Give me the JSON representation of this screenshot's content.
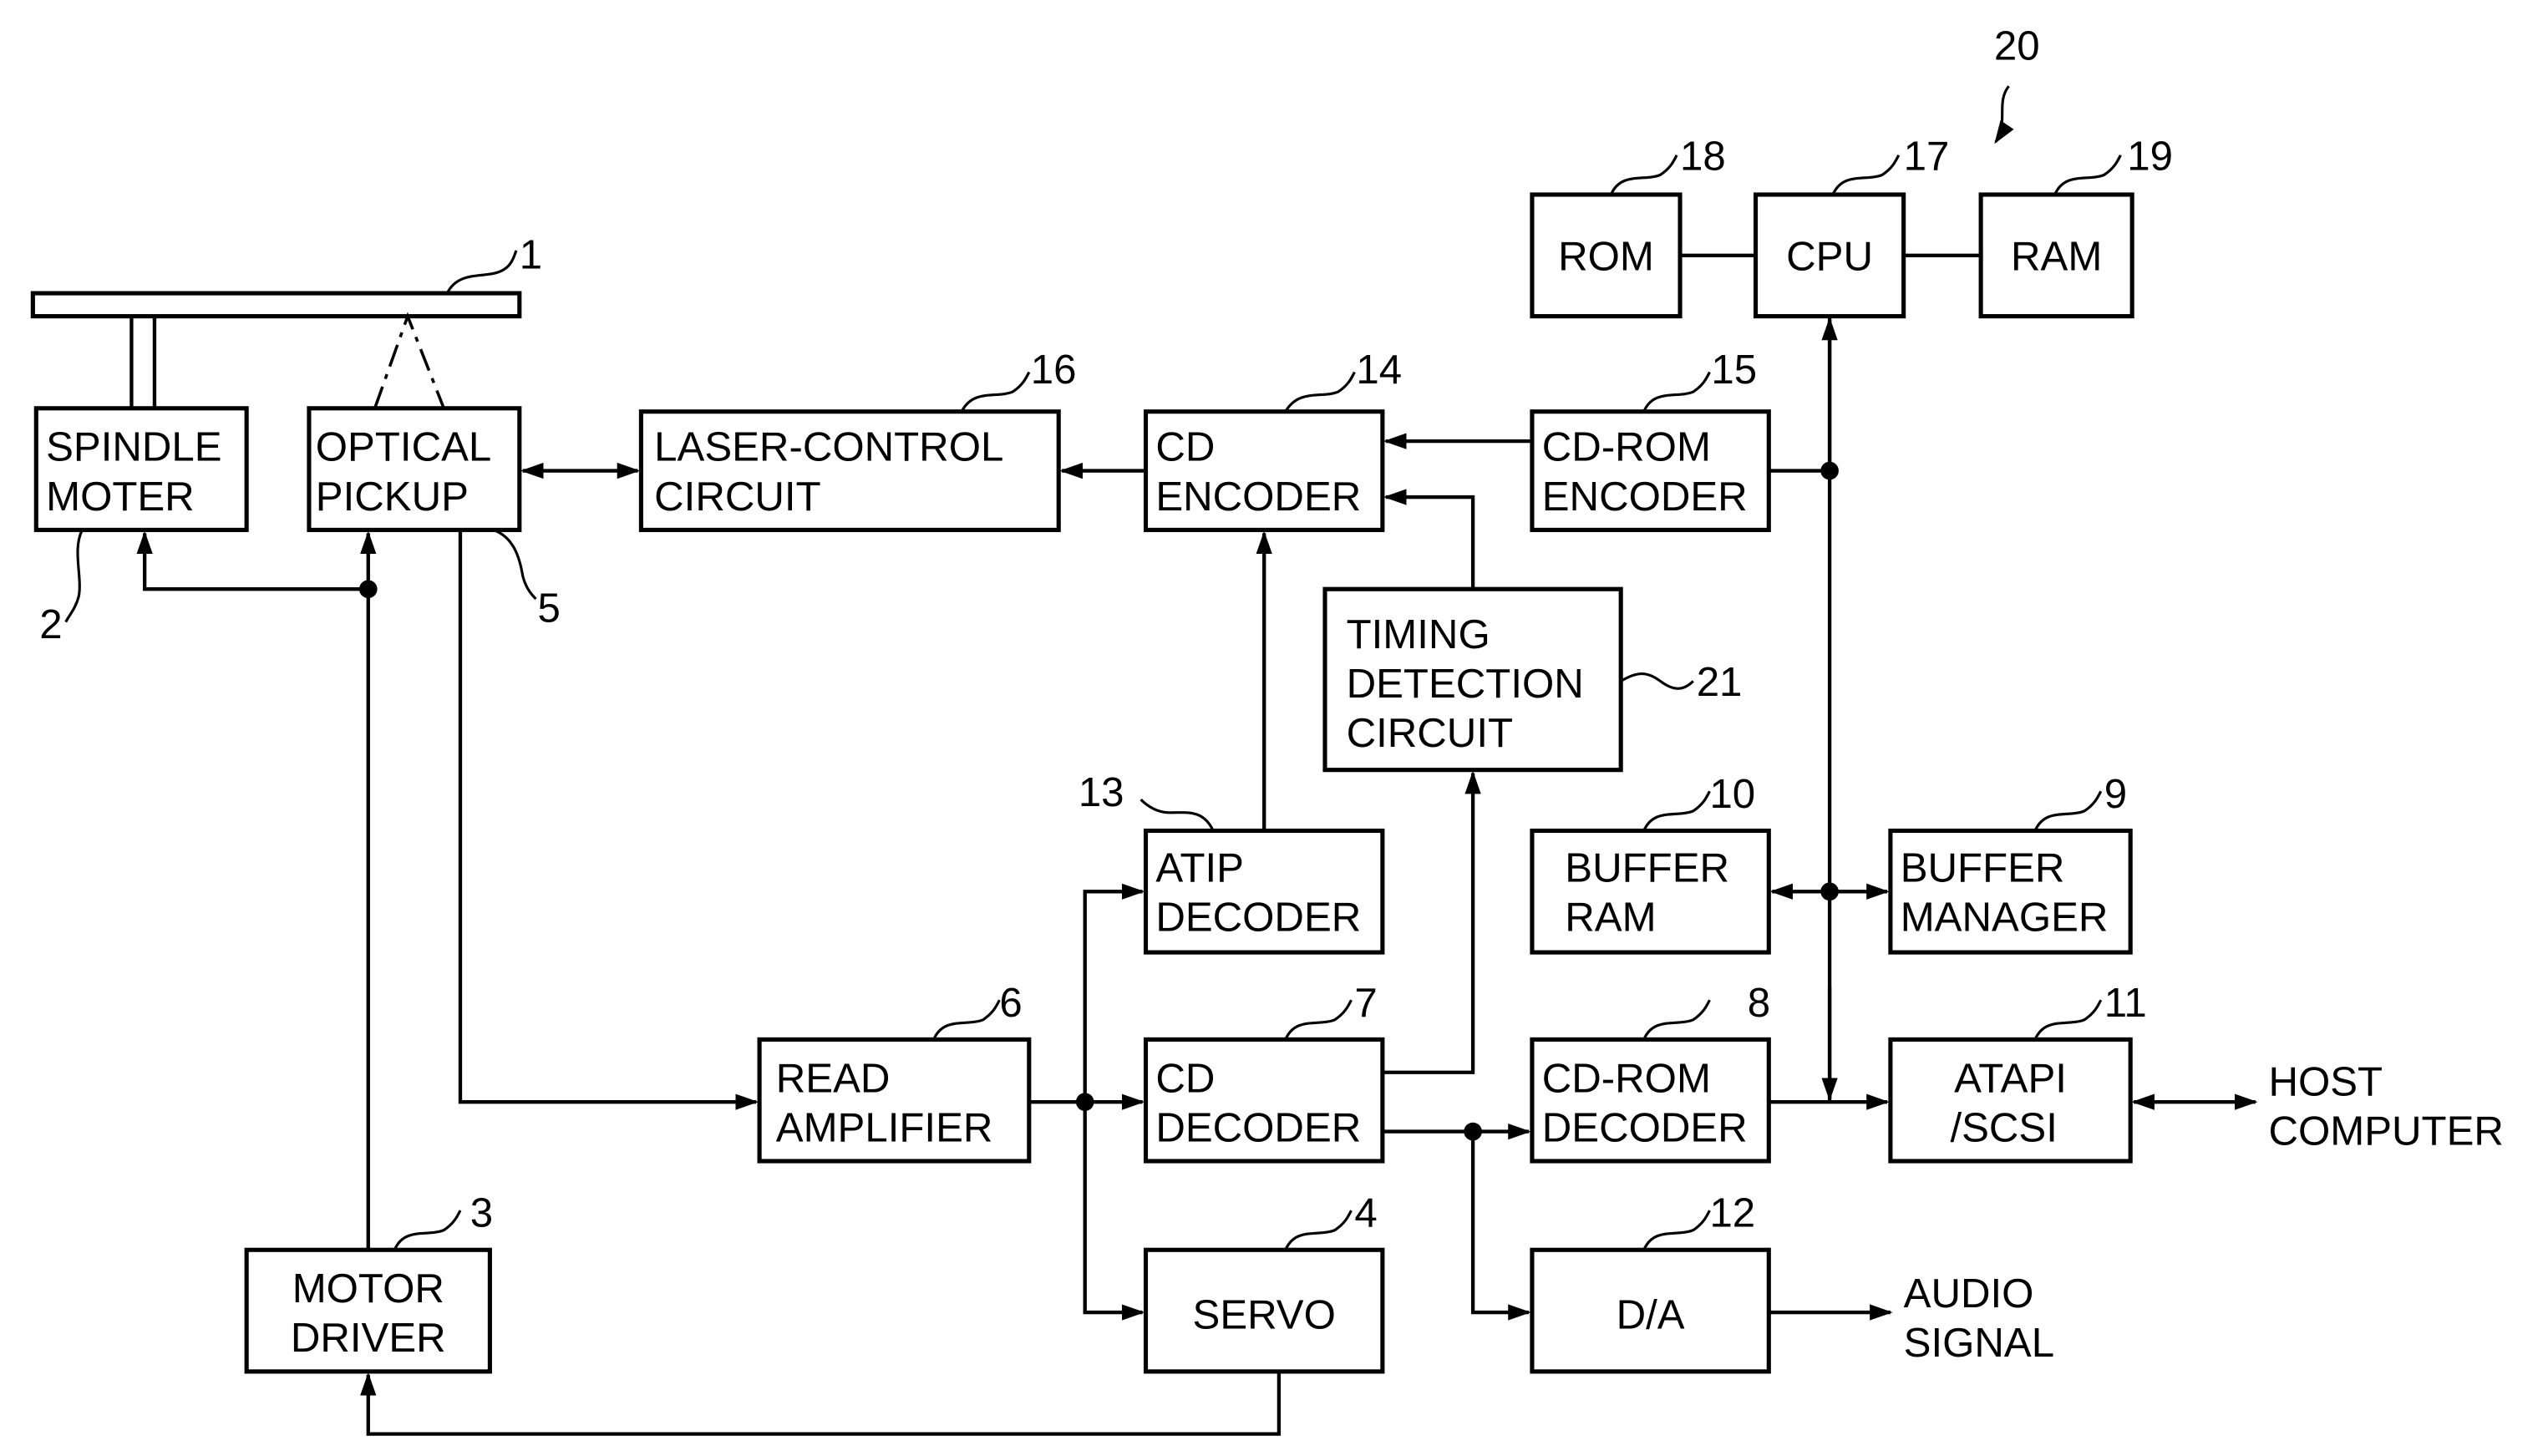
{
  "figure": {
    "type": "block-diagram",
    "subject": "optical disc (CD-R/RW) drive controller"
  },
  "blocks": {
    "disc": {
      "ref": "1"
    },
    "spindle_motor": {
      "ref": "2",
      "line1": "SPINDLE",
      "line2": "MOTER"
    },
    "motor_driver": {
      "ref": "3",
      "line1": "MOTOR",
      "line2": "DRIVER"
    },
    "servo": {
      "ref": "4",
      "line1": "SERVO"
    },
    "optical_pickup": {
      "ref": "5",
      "line1": "OPTICAL",
      "line2": "PICKUP"
    },
    "read_amplifier": {
      "ref": "6",
      "line1": "READ",
      "line2": "AMPLIFIER"
    },
    "cd_decoder": {
      "ref": "7",
      "line1": "CD",
      "line2": "DECODER"
    },
    "cdrom_decoder": {
      "ref": "8",
      "line1": "CD-ROM",
      "line2": "DECODER"
    },
    "buffer_manager": {
      "ref": "9",
      "line1": "BUFFER",
      "line2": "MANAGER"
    },
    "buffer_ram": {
      "ref": "10",
      "line1": "BUFFER",
      "line2": "RAM"
    },
    "atapi_scsi": {
      "ref": "11",
      "line1": "ATAPI",
      "line2": "/SCSI"
    },
    "da": {
      "ref": "12",
      "line1": "D/A"
    },
    "atip_decoder": {
      "ref": "13",
      "line1": "ATIP",
      "line2": "DECODER"
    },
    "cd_encoder": {
      "ref": "14",
      "line1": "CD",
      "line2": "ENCODER"
    },
    "cdrom_encoder": {
      "ref": "15",
      "line1": "CD-ROM",
      "line2": "ENCODER"
    },
    "laser_control": {
      "ref": "16",
      "line1": "LASER-CONTROL",
      "line2": "CIRCUIT"
    },
    "cpu": {
      "ref": "17",
      "line1": "CPU"
    },
    "rom": {
      "ref": "18",
      "line1": "ROM"
    },
    "ram": {
      "ref": "19",
      "line1": "RAM"
    },
    "timing_detection": {
      "ref": "21",
      "line1": "TIMING",
      "line2": "DETECTION",
      "line3": "CIRCUIT"
    }
  },
  "group_ref": "20",
  "external": {
    "host_line1": "HOST",
    "host_line2": "COMPUTER",
    "audio_line1": "AUDIO",
    "audio_line2": "SIGNAL"
  }
}
